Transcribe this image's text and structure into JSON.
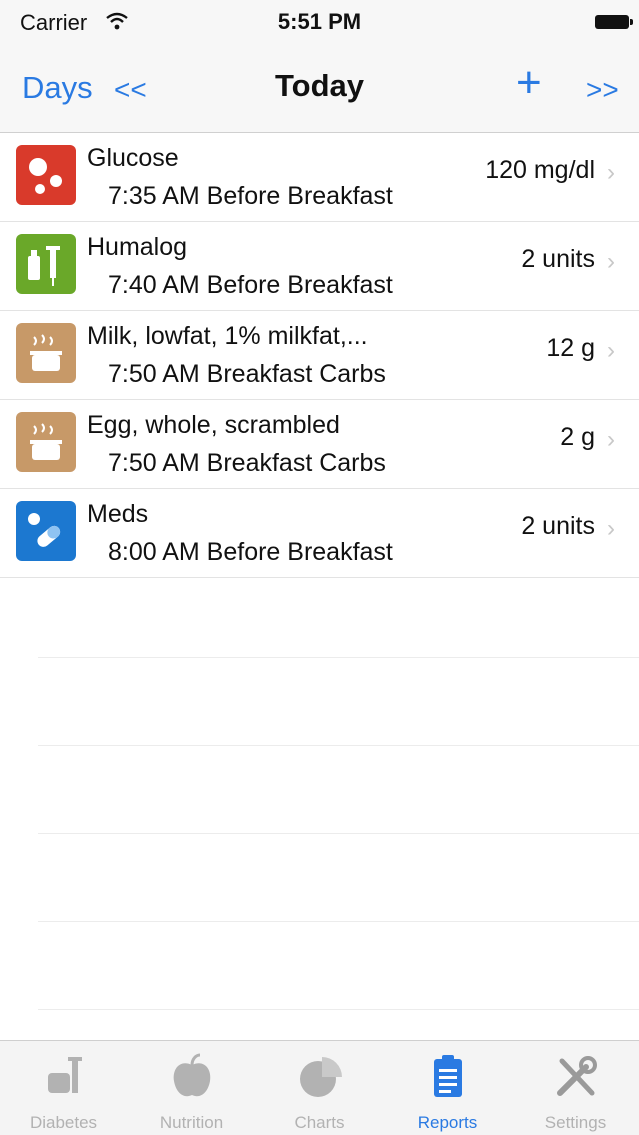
{
  "status_bar": {
    "carrier": "Carrier",
    "time": "5:51 PM"
  },
  "nav": {
    "days_label": "Days",
    "prev_label": "<<",
    "title": "Today",
    "add_label": "+",
    "next_label": ">>"
  },
  "entries": [
    {
      "title": "Glucose",
      "subtitle": "7:35 AM Before Breakfast",
      "value": "120 mg/dl",
      "icon": "glucose-icon",
      "icon_color": "#d93a2b"
    },
    {
      "title": "Humalog",
      "subtitle": "7:40 AM Before Breakfast",
      "value": "2 units",
      "icon": "insulin-icon",
      "icon_color": "#6aa829"
    },
    {
      "title": "Milk, lowfat, 1% milkfat,...",
      "subtitle": "7:50 AM Breakfast Carbs",
      "value": "12 g",
      "icon": "food-pot-icon",
      "icon_color": "#c79968"
    },
    {
      "title": "Egg, whole, scrambled",
      "subtitle": "7:50 AM Breakfast Carbs",
      "value": "2 g",
      "icon": "food-pot-icon",
      "icon_color": "#c79968"
    },
    {
      "title": "Meds",
      "subtitle": "8:00 AM Before Breakfast",
      "value": "2 units",
      "icon": "pills-icon",
      "icon_color": "#1c78d0"
    }
  ],
  "tabs": [
    {
      "label": "Diabetes",
      "icon": "diabetes-icon",
      "active": false
    },
    {
      "label": "Nutrition",
      "icon": "apple-icon",
      "active": false
    },
    {
      "label": "Charts",
      "icon": "pie-chart-icon",
      "active": false
    },
    {
      "label": "Reports",
      "icon": "clipboard-icon",
      "active": true
    },
    {
      "label": "Settings",
      "icon": "tools-icon",
      "active": false
    }
  ],
  "colors": {
    "accent": "#2a7ae2",
    "inactive_tab": "#b2b2b2"
  }
}
